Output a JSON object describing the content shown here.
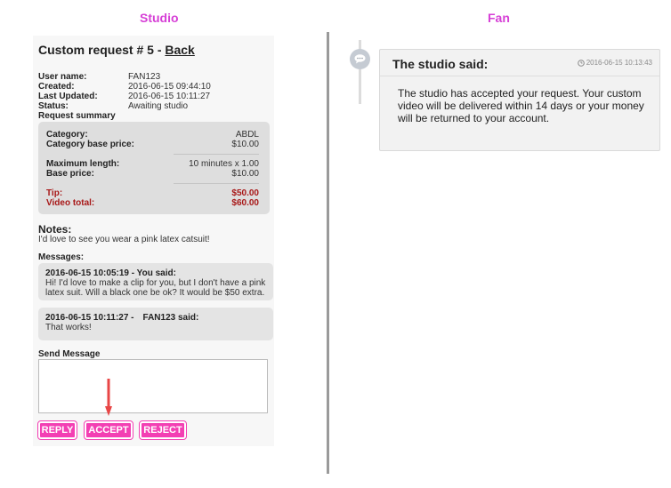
{
  "columns": {
    "studio": "Studio",
    "fan": "Fan"
  },
  "request": {
    "title_prefix": "Custom request # 5 - ",
    "back_label": "Back",
    "info": [
      {
        "label": "User name:",
        "value": "FAN123"
      },
      {
        "label": "Created:",
        "value": "2016-06-15 09:44:10"
      },
      {
        "label": "Last Updated:",
        "value": "2016-06-15 10:11:27"
      },
      {
        "label": "Status:",
        "value": "Awaiting studio"
      }
    ],
    "summary_label": "Request summary",
    "summary": {
      "category_label": "Category:",
      "category": "ABDL",
      "base_price_label": "Category base price:",
      "base_price": "$10.00",
      "max_length_label": "Maximum length:",
      "max_length": "10 minutes x 1.00",
      "base_price2_label": "Base price:",
      "base_price2": "$10.00",
      "tip_label": "Tip:",
      "tip": "$50.00",
      "total_label": "Video total:",
      "total": "$60.00"
    },
    "notes_label": "Notes:",
    "notes": "I'd love to see you wear a pink latex catsuit!",
    "messages_label": "Messages:",
    "messages": [
      {
        "header": "2016-06-15 10:05:19 - You said:",
        "body": "Hi! I'd love to make a clip for you, but I don't have a pink latex suit. Will a black one be ok? It would be $50 extra."
      },
      {
        "header": "2016-06-15 10:11:27 -",
        "user": "FAN123 said:",
        "body": "That works!"
      }
    ],
    "send_label": "Send Message",
    "send_value": "",
    "buttons": {
      "reply": "REPLY",
      "accept": "ACCEPT",
      "reject": "REJECT"
    }
  },
  "fan_card": {
    "title": "The studio said:",
    "timestamp": "2016-06-15 10:13:43",
    "body": "The studio has accepted your request. Your custom video will be delivered within 14 days or your money will be returned to your account."
  },
  "colors": {
    "accent": "#f33fb3",
    "title": "#d63fd6",
    "money": "#a81818",
    "arrow": "#e84646"
  },
  "icons": {
    "timeline": "chat-bubble-icon",
    "timestamp": "clock-icon",
    "pointer": "down-arrow-icon"
  }
}
